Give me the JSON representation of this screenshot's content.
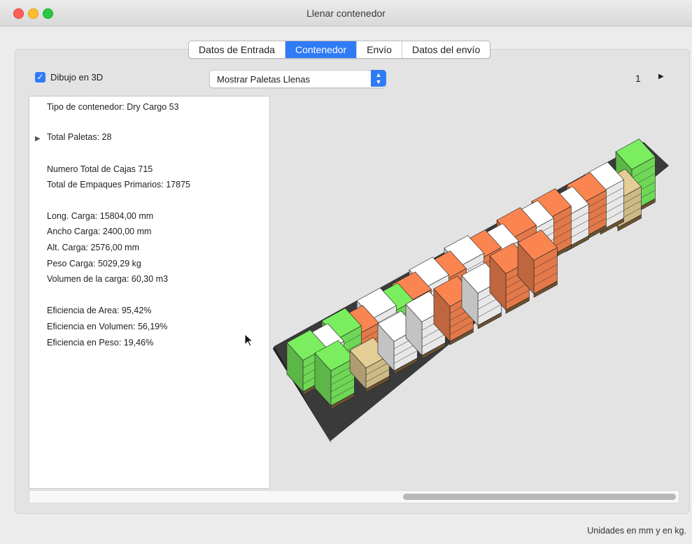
{
  "window": {
    "title": "Llenar contenedor"
  },
  "tabs": [
    {
      "label": "Datos de Entrada"
    },
    {
      "label": "Contenedor"
    },
    {
      "label": "Envío"
    },
    {
      "label": "Datos del envío"
    }
  ],
  "active_tab": "Contenedor",
  "toolbar": {
    "draw3d_label": "Dibujo en 3D",
    "draw3d_checked": true,
    "display_select_value": "Mostrar Paletas Llenas",
    "page_number": "1"
  },
  "info": {
    "container_type": "Tipo de contenedor: Dry Cargo 53",
    "total_pallets": "Total Paletas: 28",
    "total_boxes": "Numero Total de Cajas 715",
    "total_primary": "Total de Empaques Primarios: 17875",
    "load_length": "Long. Carga: 15804,00 mm",
    "load_width": "Ancho Carga: 2400,00 mm",
    "load_height": "Alt. Carga: 2576,00 mm",
    "load_weight": "Peso Carga: 5029,29 kg",
    "load_volume": "Volumen de la carga: 60,30 m3",
    "area_efficiency": "Eficiencia de Area: 95,42%",
    "volume_efficiency": "Eficiencia en Volumen: 56,19%",
    "weight_efficiency": "Eficiencia en Peso: 19,46%"
  },
  "footer": {
    "units_note": "Unidades en mm y en kg."
  },
  "icons": {
    "checkbox": "checkmark-icon",
    "select": "updown-chevron-icon",
    "next": "triangle-right-icon",
    "disclosure": "triangle-right-icon"
  },
  "colors": {
    "accent": "#2f7bf6",
    "pallet_orange": "#ef7f4d",
    "pallet_green": "#74e35a",
    "pallet_white": "#f4f4f4",
    "pallet_tan": "#d9c48e",
    "container_floor": "#3a3a3a"
  }
}
